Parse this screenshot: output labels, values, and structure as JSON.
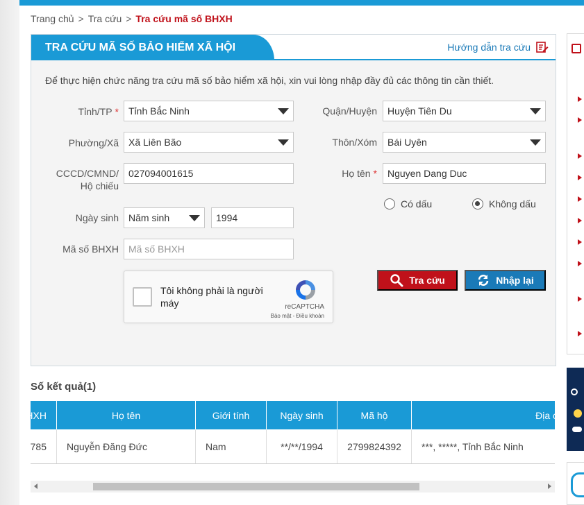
{
  "breadcrumb": {
    "items": [
      "Trang chủ",
      "Tra cứu"
    ],
    "current": "Tra cứu mã số BHXH",
    "separator": ">"
  },
  "panel": {
    "title": "TRA CỨU MÃ SỐ BẢO HIỂM XÃ HỘI",
    "guide_label": "Hướng dẫn tra cứu",
    "intro": "Để thực hiện chức năng tra cứu mã số bảo hiểm xã hội, xin vui lòng nhập đầy đủ các thông tin cần thiết."
  },
  "form": {
    "province": {
      "label": "Tỉnh/TP",
      "required_mark": "*",
      "value": "Tỉnh Bắc Ninh"
    },
    "district": {
      "label": "Quận/Huyện",
      "value": "Huyện Tiên Du"
    },
    "ward": {
      "label": "Phường/Xã",
      "value": "Xã Liên Bão"
    },
    "hamlet": {
      "label": "Thôn/Xóm",
      "value": "Bái Uyên"
    },
    "id_number": {
      "label_line1": "CCCD/CMND/",
      "label_line2": "Hộ chiếu",
      "value": "027094001615"
    },
    "full_name": {
      "label": "Họ tên",
      "required_mark": "*",
      "value": "Nguyen Dang Duc"
    },
    "diacritics": {
      "option_with": "Có dấu",
      "option_without": "Không dấu",
      "selected": "Không dấu"
    },
    "birth": {
      "label": "Ngày sinh",
      "type_value": "Năm sinh",
      "value": "1994"
    },
    "bhxh_code": {
      "label": "Mã số BHXH",
      "placeholder": "Mã số BHXH"
    }
  },
  "captcha": {
    "text": "Tôi không phải là người máy",
    "brand": "reCAPTCHA",
    "links": "Bảo mật - Điều khoản"
  },
  "buttons": {
    "search": "Tra cứu",
    "reset": "Nhập lại"
  },
  "results": {
    "title": "Số kết quả(1)",
    "headers": [
      "BHXH",
      "Họ tên",
      "Giới tính",
      "Ngày sinh",
      "Mã hộ",
      "Địa c"
    ],
    "rows": [
      [
        "785",
        "Nguyễn Đăng Đức",
        "Nam",
        "**/**/1994",
        "2799824392",
        "***, *****, Tỉnh Bắc Ninh"
      ]
    ]
  },
  "colors": {
    "primary_blue": "#1a9ad6",
    "accent_red": "#c0111a",
    "reset_blue": "#1a7ab8"
  }
}
